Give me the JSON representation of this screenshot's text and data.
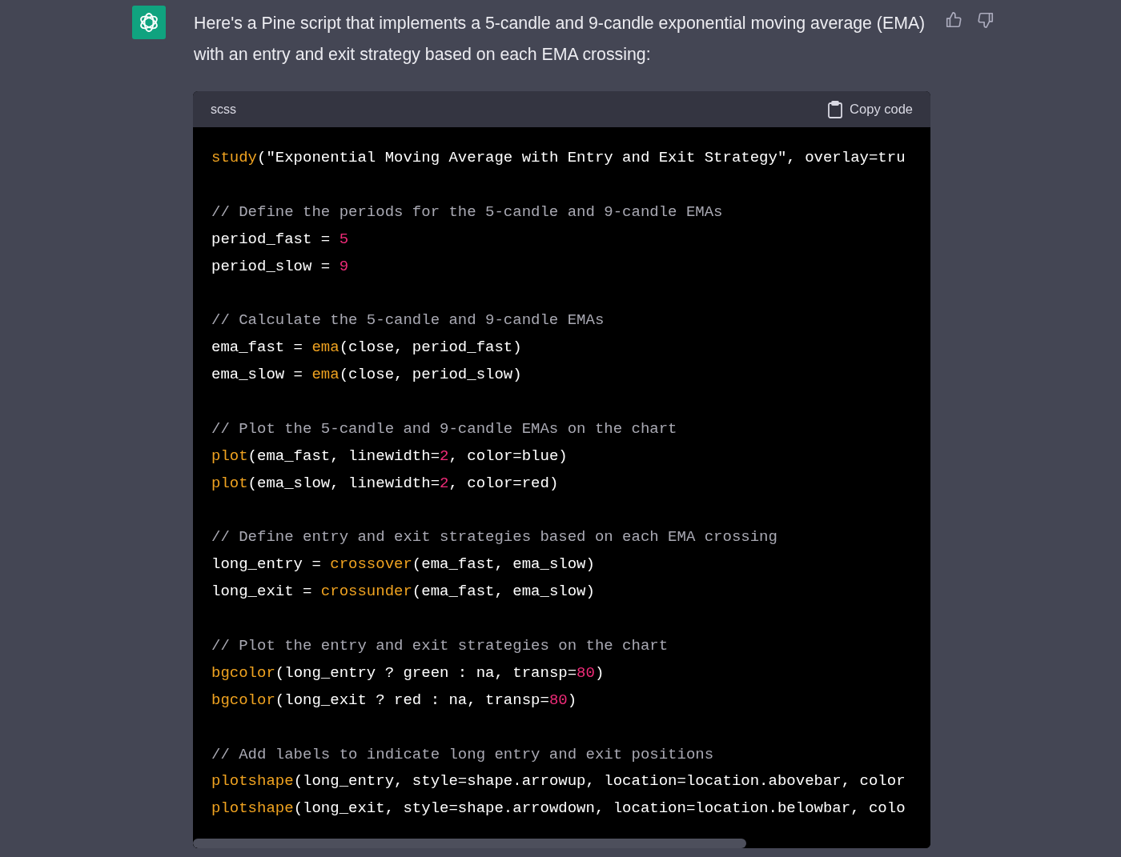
{
  "message": {
    "text": "Here's a Pine script that implements a 5-candle and 9-candle exponential moving average (EMA) with an entry and exit strategy based on each EMA crossing:"
  },
  "code_block": {
    "language": "scss",
    "copy_label": "Copy code",
    "blocks": [
      [
        [
          {
            "kind": "func",
            "text": "study"
          },
          {
            "kind": "plain",
            "text": "(\"Exponential Moving Average with Entry and Exit Strategy\", overlay=tru"
          }
        ]
      ],
      [
        [
          {
            "kind": "comment",
            "text": "// Define the periods for the 5-candle and 9-candle EMAs"
          }
        ],
        [
          {
            "kind": "plain",
            "text": "period_fast = "
          },
          {
            "kind": "number",
            "text": "5"
          }
        ],
        [
          {
            "kind": "plain",
            "text": "period_slow = "
          },
          {
            "kind": "number",
            "text": "9"
          }
        ]
      ],
      [
        [
          {
            "kind": "comment",
            "text": "// Calculate the 5-candle and 9-candle EMAs"
          }
        ],
        [
          {
            "kind": "plain",
            "text": "ema_fast = "
          },
          {
            "kind": "func",
            "text": "ema"
          },
          {
            "kind": "plain",
            "text": "(close, period_fast)"
          }
        ],
        [
          {
            "kind": "plain",
            "text": "ema_slow = "
          },
          {
            "kind": "func",
            "text": "ema"
          },
          {
            "kind": "plain",
            "text": "(close, period_slow)"
          }
        ]
      ],
      [
        [
          {
            "kind": "comment",
            "text": "// Plot the 5-candle and 9-candle EMAs on the chart"
          }
        ],
        [
          {
            "kind": "func",
            "text": "plot"
          },
          {
            "kind": "plain",
            "text": "(ema_fast, linewidth="
          },
          {
            "kind": "number",
            "text": "2"
          },
          {
            "kind": "plain",
            "text": ", color=blue)"
          }
        ],
        [
          {
            "kind": "func",
            "text": "plot"
          },
          {
            "kind": "plain",
            "text": "(ema_slow, linewidth="
          },
          {
            "kind": "number",
            "text": "2"
          },
          {
            "kind": "plain",
            "text": ", color=red)"
          }
        ]
      ],
      [
        [
          {
            "kind": "comment",
            "text": "// Define entry and exit strategies based on each EMA crossing"
          }
        ],
        [
          {
            "kind": "plain",
            "text": "long_entry = "
          },
          {
            "kind": "func",
            "text": "crossover"
          },
          {
            "kind": "plain",
            "text": "(ema_fast, ema_slow)"
          }
        ],
        [
          {
            "kind": "plain",
            "text": "long_exit = "
          },
          {
            "kind": "func",
            "text": "crossunder"
          },
          {
            "kind": "plain",
            "text": "(ema_fast, ema_slow)"
          }
        ]
      ],
      [
        [
          {
            "kind": "comment",
            "text": "// Plot the entry and exit strategies on the chart"
          }
        ],
        [
          {
            "kind": "func",
            "text": "bgcolor"
          },
          {
            "kind": "plain",
            "text": "(long_entry ? green : na, transp="
          },
          {
            "kind": "number",
            "text": "80"
          },
          {
            "kind": "plain",
            "text": ")"
          }
        ],
        [
          {
            "kind": "func",
            "text": "bgcolor"
          },
          {
            "kind": "plain",
            "text": "(long_exit ? red : na, transp="
          },
          {
            "kind": "number",
            "text": "80"
          },
          {
            "kind": "plain",
            "text": ")"
          }
        ]
      ],
      [
        [
          {
            "kind": "comment",
            "text": "// Add labels to indicate long entry and exit positions"
          }
        ],
        [
          {
            "kind": "func",
            "text": "plotshape"
          },
          {
            "kind": "plain",
            "text": "(long_entry, style=shape.arrowup, location=location.abovebar, color"
          }
        ],
        [
          {
            "kind": "func",
            "text": "plotshape"
          },
          {
            "kind": "plain",
            "text": "(long_exit, style=shape.arrowdown, location=location.belowbar, colo"
          }
        ]
      ]
    ]
  }
}
